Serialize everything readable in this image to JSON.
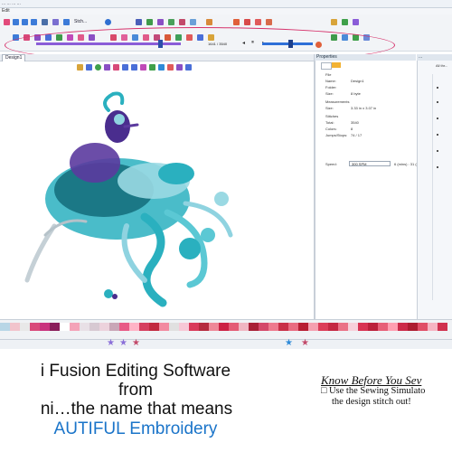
{
  "window": {
    "title": "...   ...   ...   ..."
  },
  "menubar": {
    "label": "Edit"
  },
  "toolbar": {
    "zoom_label": "Stch...",
    "stitch_count": "1641 / 3540"
  },
  "canvas": {
    "tab_label": "Design1",
    "image_name": "embroidered-peacock-bird-design"
  },
  "properties": {
    "header": "Properties",
    "rows": [
      {
        "label": "File",
        "value": ""
      },
      {
        "label": "Name:",
        "value": "Design1"
      },
      {
        "label": "Folder:",
        "value": ""
      },
      {
        "label": "Size:",
        "value": "8 byte"
      },
      {
        "label": "Measurements",
        "value": ""
      },
      {
        "label": "Size:",
        "value": "3.33 in x 3.07 in"
      },
      {
        "label": "Stitches",
        "value": ""
      },
      {
        "label": "Total:",
        "value": "3540"
      },
      {
        "label": "Colors:",
        "value": "8"
      },
      {
        "label": "Jumps/Stops:",
        "value": "74 / 17"
      }
    ],
    "speed_label": "Speed:",
    "speed_value": "300 SPM",
    "speed_extra": "6 (mins) : 31 (sec)"
  },
  "right_panel": {
    "header": "...",
    "sub_label": "All thr..."
  },
  "palette": {
    "colors": [
      "#b8d6e6",
      "#f2c4cc",
      "#e8e8e8",
      "#d94a7a",
      "#c9337e",
      "#8a1d5a",
      "#ffffff",
      "#f4a3b8",
      "#e8e0e6",
      "#d7c9d2",
      "#ecd2dc",
      "#c9a6b7",
      "#e85a86",
      "#ffb3c6",
      "#d63f5f",
      "#c22a40",
      "#f28aa0",
      "#e0e0e0",
      "#f7c8d6",
      "#d93a5a",
      "#b52a3e",
      "#ee8898",
      "#cc2244",
      "#e45c75",
      "#f0b6c2",
      "#a82036",
      "#d4486a",
      "#ee7a8e",
      "#c93048",
      "#e96b80",
      "#b81e32",
      "#f5a0b0",
      "#dc3d58",
      "#c42842",
      "#ea7286",
      "#f7d0da",
      "#d83352",
      "#bb203a",
      "#e75f77",
      "#ff9fb1",
      "#cc2a48",
      "#ad1c30",
      "#e04e66",
      "#f6b4c2",
      "#d0314e"
    ]
  },
  "captions": {
    "line1": "i Fusion Editing Software",
    "line2": "from",
    "line3": "ni…the name that means",
    "line4": "AUTIFUL Embroidery"
  },
  "note": {
    "heading": "Know Before You Sev",
    "line1": "Use the Sewing Simulato",
    "line2": "the design stitch out!"
  },
  "colors": {
    "highlight_oval": "#d6336c",
    "slider_purple": "#8a5cd8",
    "slider_blue": "#2e6fd8",
    "caption_blue": "#1a74c9"
  }
}
